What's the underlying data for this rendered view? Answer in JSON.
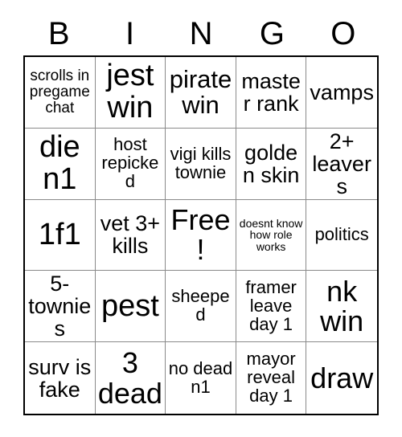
{
  "card": {
    "header_letters": [
      "B",
      "I",
      "N",
      "G",
      "O"
    ],
    "columns": 5,
    "rows": 5,
    "free_space_label": "Free!",
    "free_space_index": 12,
    "colors": {
      "background": "#ffffff",
      "text": "#000000",
      "grid_line": "#8a8a8a",
      "outer_border": "#000000"
    },
    "cells": [
      {
        "text": "scrolls in pregame chat",
        "size": "fs-xs",
        "marked": false
      },
      {
        "text": "jest win",
        "size": "fs-xxl",
        "marked": false
      },
      {
        "text": "pirate win",
        "size": "fs-lg",
        "marked": false
      },
      {
        "text": "master rank",
        "size": "fs-md",
        "marked": false
      },
      {
        "text": "vamps",
        "size": "fs-md",
        "marked": false
      },
      {
        "text": "die n1",
        "size": "fs-xxl",
        "marked": false
      },
      {
        "text": "host repicked",
        "size": "fs-sm",
        "marked": false
      },
      {
        "text": "vigi kills townie",
        "size": "fs-sm",
        "marked": false
      },
      {
        "text": "golden skin",
        "size": "fs-md",
        "marked": false
      },
      {
        "text": "2+ leavers",
        "size": "fs-md",
        "marked": false
      },
      {
        "text": "1f1",
        "size": "fs-xxl",
        "marked": false
      },
      {
        "text": "vet 3+ kills",
        "size": "fs-md",
        "marked": false
      },
      {
        "text": "Free!",
        "size": "fs-xl",
        "marked": false
      },
      {
        "text": "doesnt know how role works",
        "size": "fs-tiny",
        "marked": false
      },
      {
        "text": "politics",
        "size": "fs-sm",
        "marked": false
      },
      {
        "text": "5- townies",
        "size": "fs-md",
        "marked": false
      },
      {
        "text": "pest",
        "size": "fs-xxl",
        "marked": false
      },
      {
        "text": "sheeped",
        "size": "fs-sm",
        "marked": false
      },
      {
        "text": "framer leave day 1",
        "size": "fs-sm",
        "marked": false
      },
      {
        "text": "nk win",
        "size": "fs-xl",
        "marked": false
      },
      {
        "text": "surv is fake",
        "size": "fs-md",
        "marked": false
      },
      {
        "text": "3 dead",
        "size": "fs-xl",
        "marked": false
      },
      {
        "text": "no dead n1",
        "size": "fs-sm",
        "marked": false
      },
      {
        "text": "mayor reveal day 1",
        "size": "fs-sm",
        "marked": false
      },
      {
        "text": "draw",
        "size": "fs-xl",
        "marked": false
      }
    ]
  }
}
